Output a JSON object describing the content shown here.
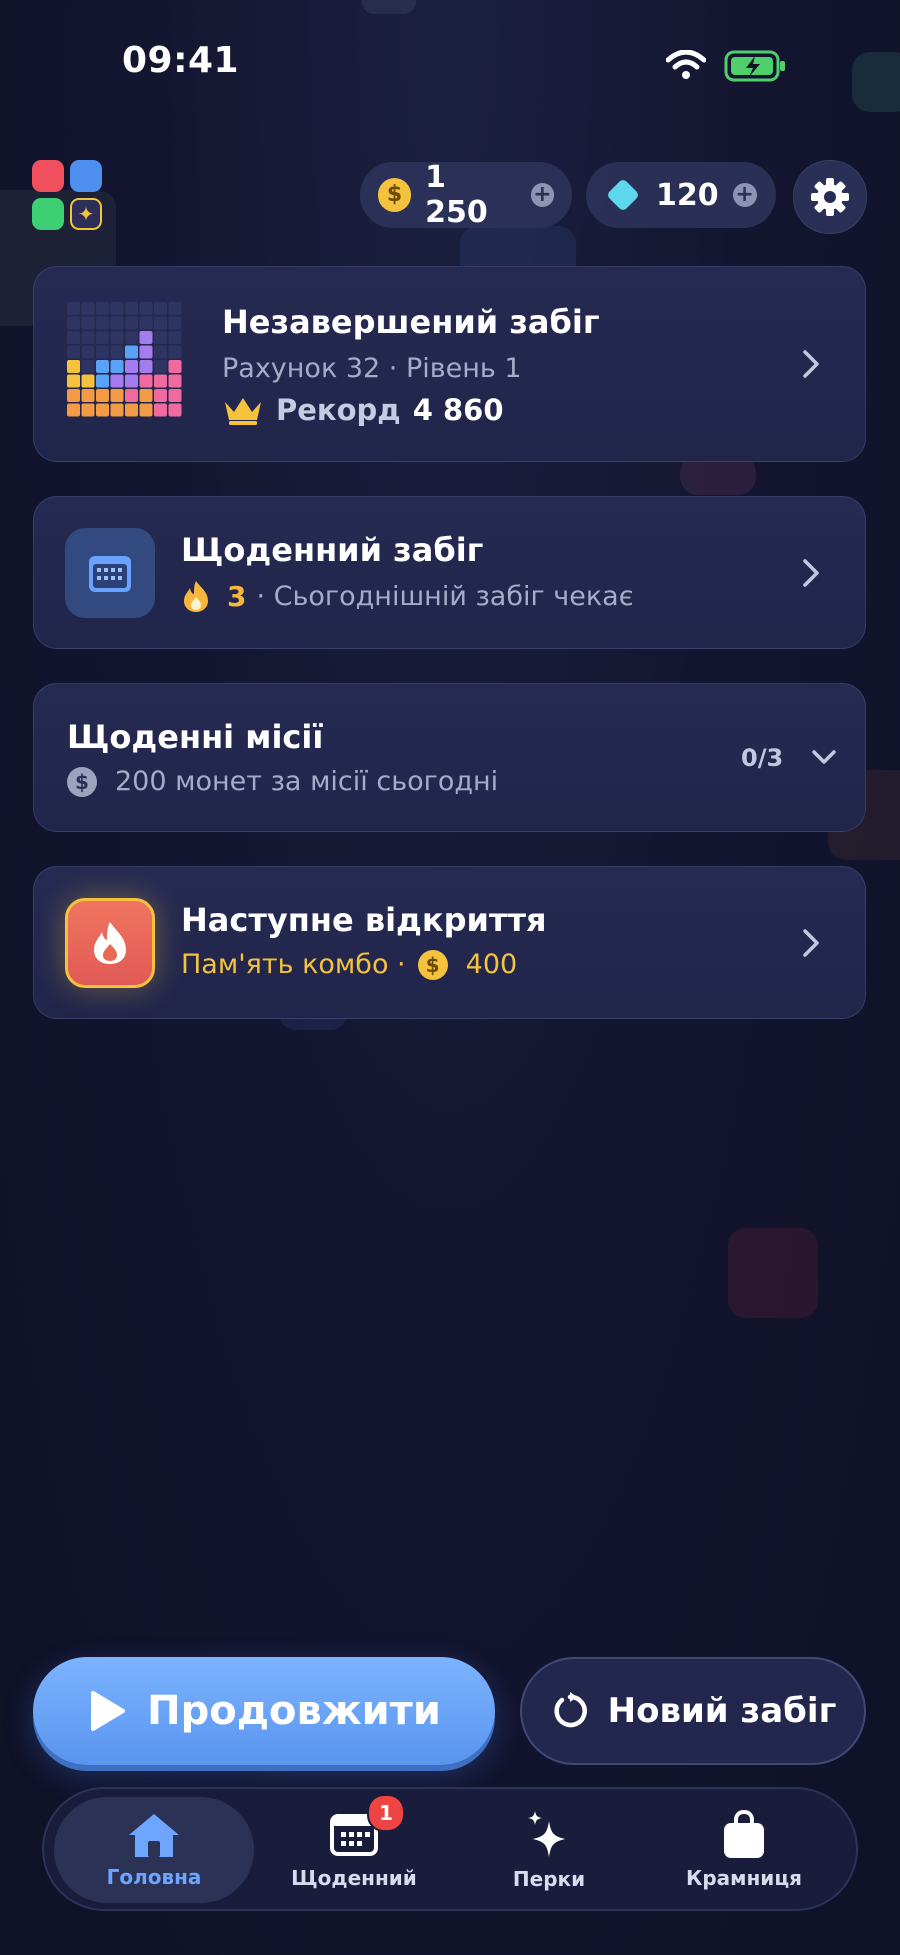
{
  "status_bar": {
    "time": "09:41"
  },
  "currency": {
    "coins": "1 250",
    "gems": "120"
  },
  "cards": {
    "unfinished_run": {
      "title": "Незавершений забіг",
      "subtitle": "Рахунок 32 · Рівень 1",
      "record_label": "Рекорд",
      "record_value": "4 860"
    },
    "daily_run": {
      "title": "Щоденний забіг",
      "streak": "3",
      "status": "· Сьогоднішній забіг чекає"
    },
    "daily_missions": {
      "title": "Щоденні місії",
      "reward_text": "200 монет за місії сьогодні",
      "progress": "0/3"
    },
    "next_unlock": {
      "title": "Наступне відкриття",
      "name": "Пам'ять комбо ·",
      "cost": "400"
    }
  },
  "actions": {
    "continue_label": "Продовжити",
    "new_run_label": "Новий забіг"
  },
  "tabbar": {
    "items": [
      {
        "label": "Головна",
        "icon": "home-icon",
        "active": true
      },
      {
        "label": "Щоденний",
        "icon": "calendar-icon",
        "badge": "1"
      },
      {
        "label": "Перки",
        "icon": "sparkle-icon"
      },
      {
        "label": "Крамниця",
        "icon": "shopping-bag-icon"
      }
    ]
  },
  "colors": {
    "accent_blue": "#6ea6ff",
    "gold": "#f5c23e",
    "gem": "#5fd8ef",
    "badge_red": "#ef4444",
    "card_bg": "#252950"
  }
}
